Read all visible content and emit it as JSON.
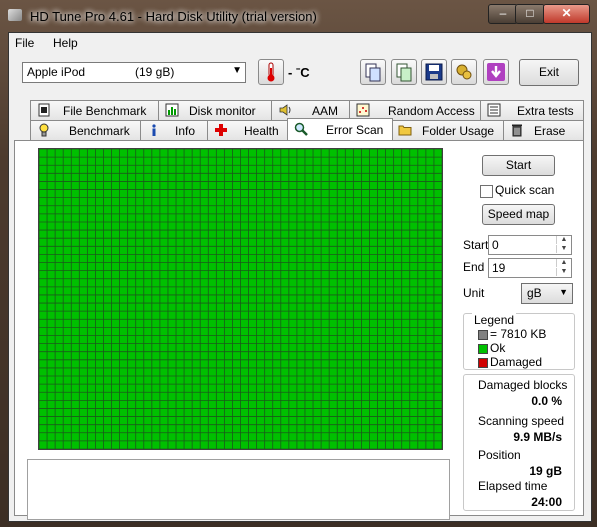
{
  "window": {
    "title": "HD Tune Pro 4.61 - Hard Disk Utility (trial version)"
  },
  "menu": {
    "file": "File",
    "help": "Help"
  },
  "toolbar": {
    "drive_name": "Apple   iPod",
    "drive_size": "(19 gB)",
    "temperature": "- ˉC",
    "exit_label": "Exit"
  },
  "tabs_top": [
    {
      "label": "File Benchmark",
      "icon": "file-benchmark-icon"
    },
    {
      "label": "Disk monitor",
      "icon": "disk-monitor-icon"
    },
    {
      "label": "AAM",
      "icon": "speaker-icon"
    },
    {
      "label": "Random Access",
      "icon": "random-access-icon"
    },
    {
      "label": "Extra tests",
      "icon": "extra-tests-icon"
    }
  ],
  "tabs_bottom": [
    {
      "label": "Benchmark",
      "icon": "lightbulb-icon"
    },
    {
      "label": "Info",
      "icon": "info-icon"
    },
    {
      "label": "Health",
      "icon": "health-cross-icon"
    },
    {
      "label": "Error Scan",
      "icon": "magnifier-icon",
      "active": true
    },
    {
      "label": "Folder Usage",
      "icon": "folder-icon"
    },
    {
      "label": "Erase",
      "icon": "trash-icon"
    }
  ],
  "scan": {
    "start_button": "Start",
    "quick_scan_label": "Quick scan",
    "quick_scan_checked": false,
    "speed_map_button": "Speed map",
    "start_label": "Start",
    "start_value": "0",
    "end_label": "End",
    "end_value": "19",
    "unit_label": "Unit",
    "unit_value": "gB"
  },
  "legend": {
    "title": "Legend",
    "block_size": "= 7810 KB",
    "ok": "Ok",
    "damaged": "Damaged",
    "colors": {
      "block": "#808080",
      "ok": "#00c000",
      "damaged": "#d00000"
    }
  },
  "stats": {
    "damaged_blocks_label": "Damaged blocks",
    "damaged_blocks_value": "0.0 %",
    "scanning_speed_label": "Scanning speed",
    "scanning_speed_value": "9.9 MB/s",
    "position_label": "Position",
    "position_value": "19 gB",
    "elapsed_time_label": "Elapsed time",
    "elapsed_time_value": "24:00"
  },
  "grid": {
    "columns": 50,
    "rows": 37,
    "cell_color": "#00c000",
    "line_color": "#1a5a1a"
  }
}
